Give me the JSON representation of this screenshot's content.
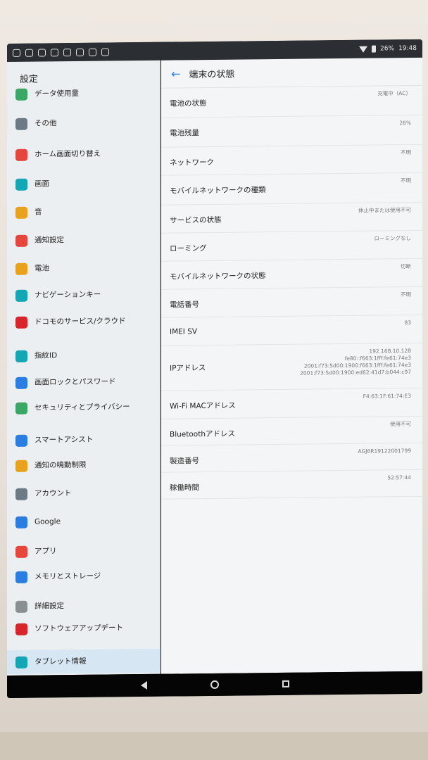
{
  "status_bar": {
    "battery": "26%",
    "time": "19:48"
  },
  "sidebar": {
    "title": "設定",
    "items": [
      {
        "label": "データ使用量",
        "color": "#3aa864"
      },
      {
        "label": "その他",
        "color": "#6c7a86"
      },
      {
        "label": "ホーム画面切り替え",
        "color": "#e5473d"
      },
      {
        "label": "画面",
        "color": "#13a7b5"
      },
      {
        "label": "音",
        "color": "#e8a21e"
      },
      {
        "label": "通知設定",
        "color": "#e5473d"
      },
      {
        "label": "電池",
        "color": "#e8a21e"
      },
      {
        "label": "ナビゲーションキー",
        "color": "#13a7b5"
      },
      {
        "label": "ドコモのサービス/クラウド",
        "color": "#d8252b"
      },
      {
        "label": "指紋ID",
        "color": "#13a7b5"
      },
      {
        "label": "画面ロックとパスワード",
        "color": "#2a7de1"
      },
      {
        "label": "セキュリティとプライバシー",
        "color": "#3aa864"
      },
      {
        "label": "スマートアシスト",
        "color": "#2a7de1"
      },
      {
        "label": "通知の鳴動制限",
        "color": "#e8a21e"
      },
      {
        "label": "アカウント",
        "color": "#6c7a86"
      },
      {
        "label": "Google",
        "color": "#2a7de1"
      },
      {
        "label": "アプリ",
        "color": "#e5473d"
      },
      {
        "label": "メモリとストレージ",
        "color": "#2a7de1"
      },
      {
        "label": "詳細設定",
        "color": "#8a8f94"
      },
      {
        "label": "ソフトウェアアップデート",
        "color": "#d8252b"
      },
      {
        "label": "タブレット情報",
        "color": "#13a7b5"
      }
    ]
  },
  "main": {
    "title": "端末の状態",
    "rows": [
      {
        "label": "電池の状態",
        "value": "充電中（AC）"
      },
      {
        "label": "電池残量",
        "value": "26%"
      },
      {
        "label": "ネットワーク",
        "value": "不明"
      },
      {
        "label": "モバイルネットワークの種類",
        "value": "不明"
      },
      {
        "label": "サービスの状態",
        "value": "休止中または使用不可"
      },
      {
        "label": "ローミング",
        "value": "ローミングなし"
      },
      {
        "label": "モバイルネットワークの状態",
        "value": "切断"
      },
      {
        "label": "電話番号",
        "value": "不明"
      },
      {
        "label": "IMEI SV",
        "value": "83"
      },
      {
        "label": "IPアドレス",
        "value": "192.168.10.128\nfe80::f663:1fff:fe61:74e3\n2001:f73:5d00:1900:f663:1fff:fe61:74e3\n2001:f73:5d00:1900:ed62:41d7:b044:c97"
      },
      {
        "label": "Wi-Fi MACアドレス",
        "value": "F4:63:1F:61:74:E3"
      },
      {
        "label": "Bluetoothアドレス",
        "value": "使用不可"
      },
      {
        "label": "製造番号",
        "value": "AGJ6R19122001799"
      },
      {
        "label": "稼働時間",
        "value": "52:57:44"
      }
    ]
  }
}
